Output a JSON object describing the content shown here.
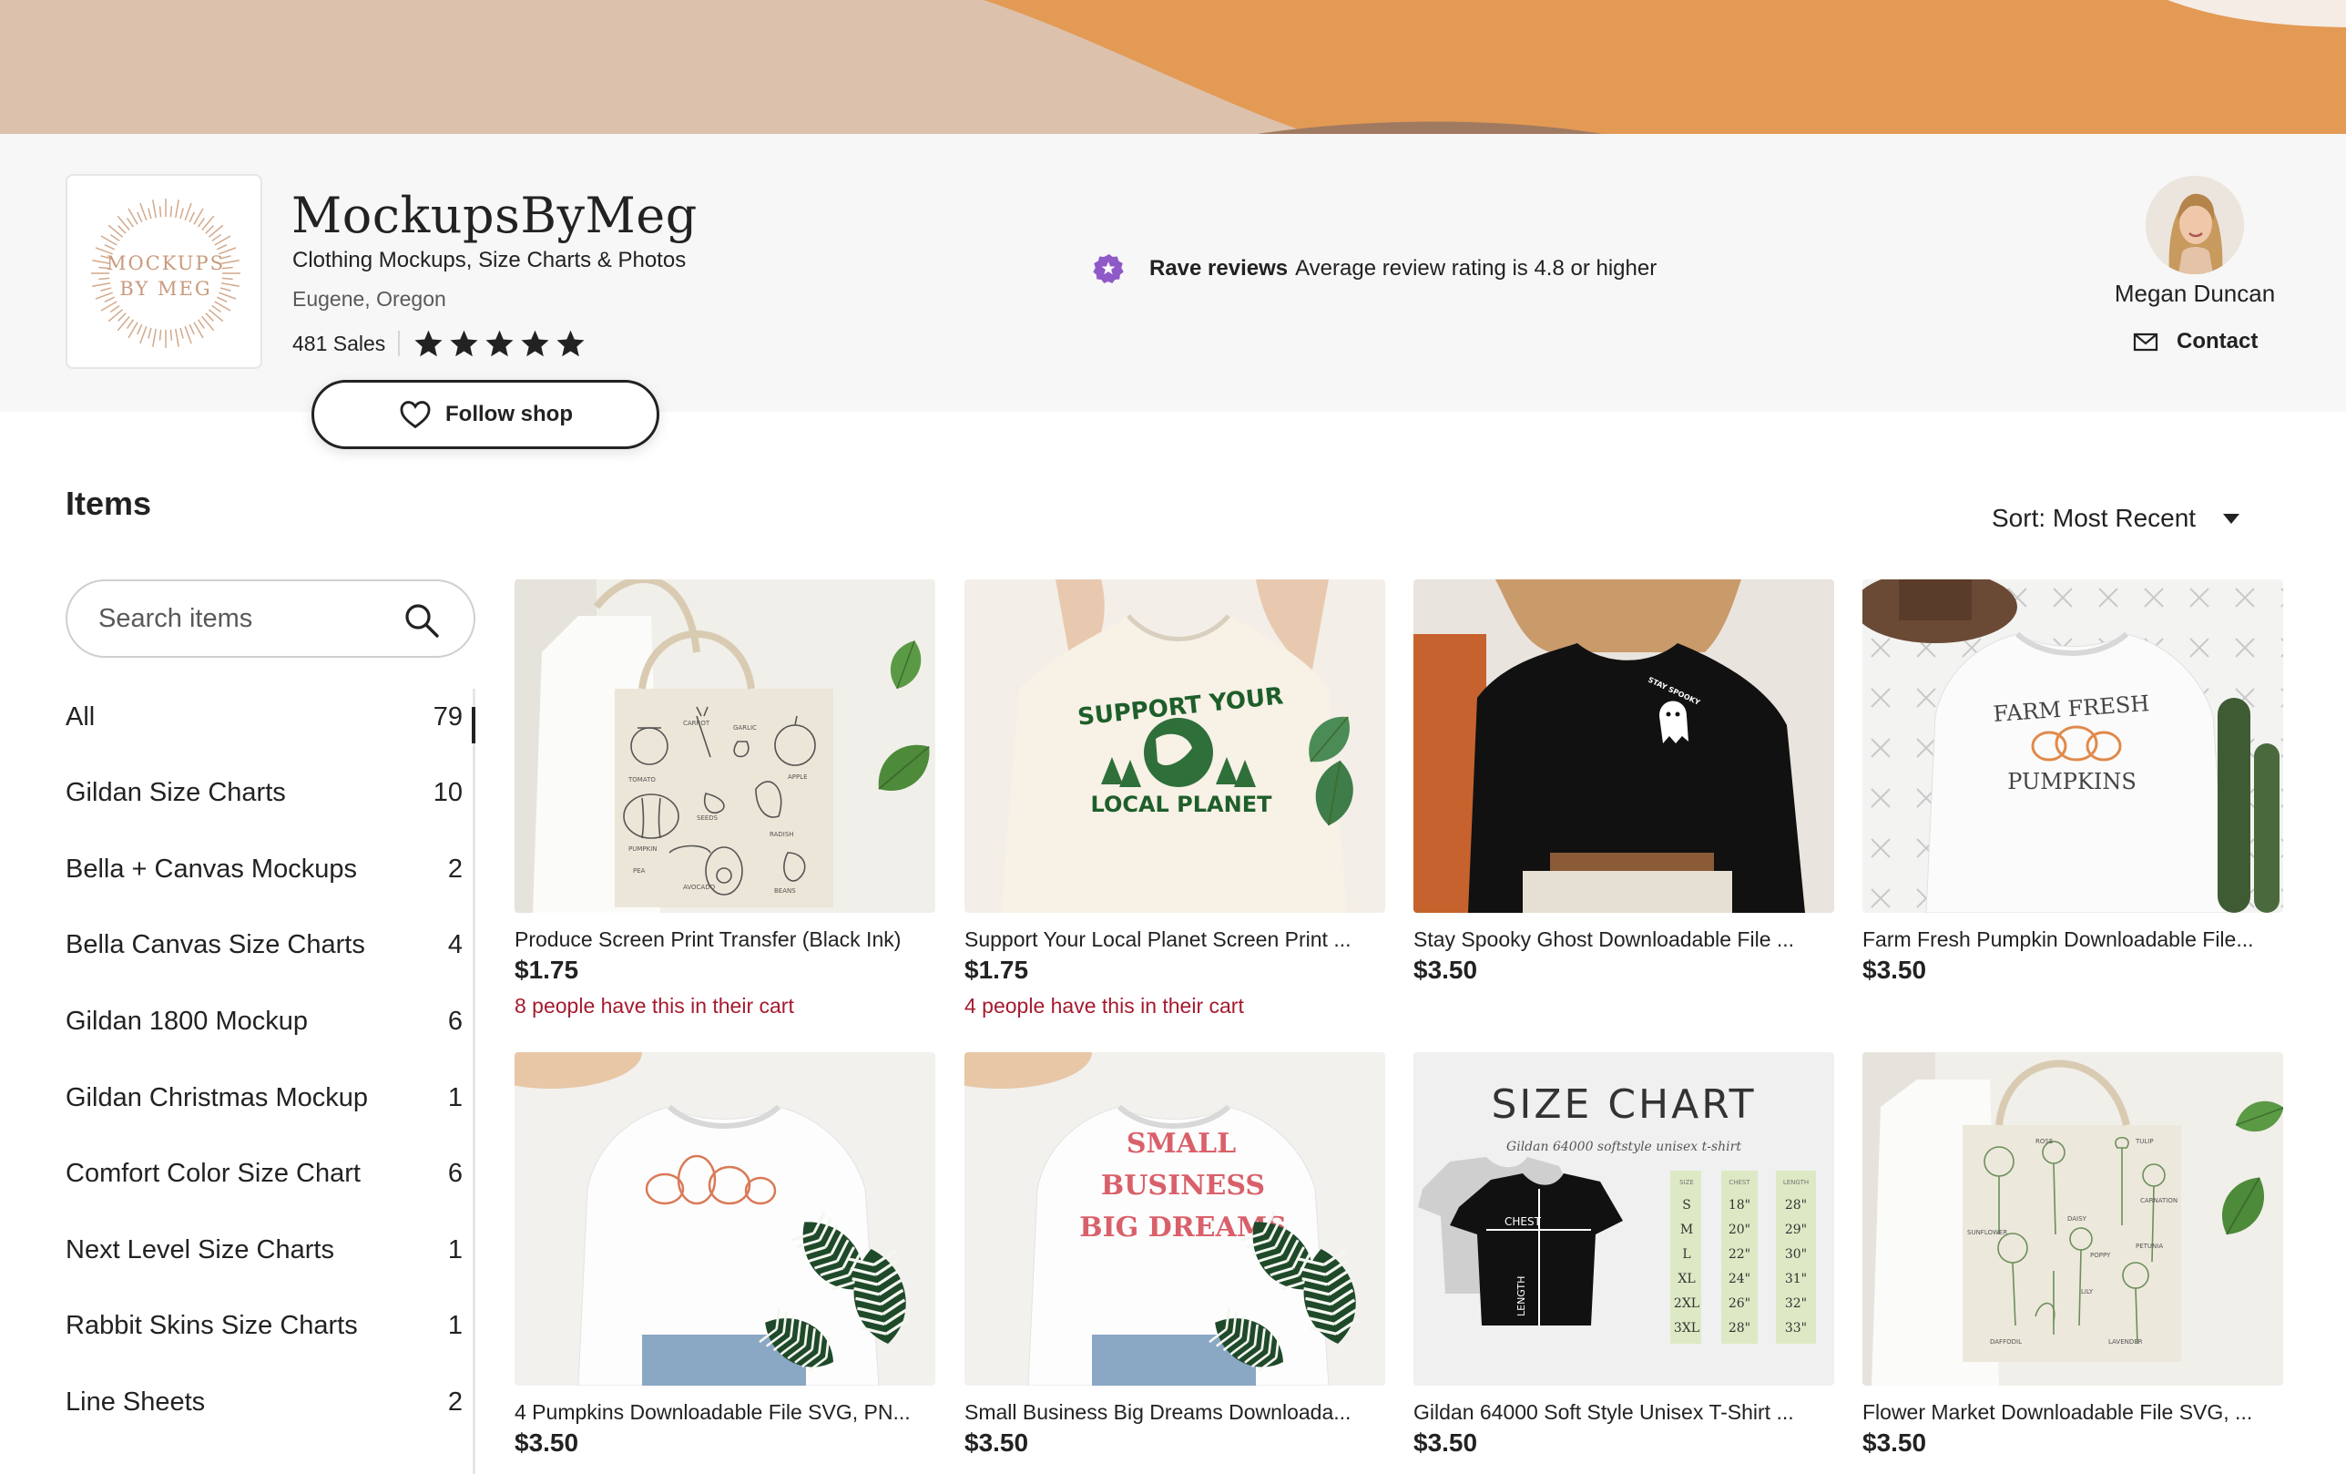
{
  "colors": {
    "banner_tan": "#dcc1ad",
    "banner_orange": "#e39a55",
    "header_bg": "#f7f7f7",
    "rave_purple": "#8f5ac7",
    "cart_red": "#a61a2e",
    "text": "#222222"
  },
  "shop": {
    "logo_line1": "MOCKUPS",
    "logo_line2": "BY MEG",
    "name": "MockupsByMeg",
    "tagline": "Clothing Mockups, Size Charts & Photos",
    "location": "Eugene, Oregon",
    "sales": "481 Sales",
    "rating_stars": 5,
    "follow_label": "Follow shop"
  },
  "badge": {
    "title": "Rave reviews",
    "description": "Average review rating is 4.8 or higher"
  },
  "owner": {
    "name": "Megan Duncan",
    "contact_label": "Contact"
  },
  "items_heading": "Items",
  "sort_label": "Sort: Most Recent",
  "search": {
    "placeholder": "Search items"
  },
  "sections": [
    {
      "label": "All",
      "count": "79"
    },
    {
      "label": "Gildan Size Charts",
      "count": "10"
    },
    {
      "label": "Bella + Canvas Mockups",
      "count": "2"
    },
    {
      "label": "Bella Canvas Size Charts",
      "count": "4"
    },
    {
      "label": "Gildan 1800 Mockup",
      "count": "6"
    },
    {
      "label": "Gildan Christmas Mockup",
      "count": "1"
    },
    {
      "label": "Comfort Color Size Chart",
      "count": "6"
    },
    {
      "label": "Next Level Size Charts",
      "count": "1"
    },
    {
      "label": "Rabbit Skins Size Charts",
      "count": "1"
    },
    {
      "label": "Line Sheets",
      "count": "2"
    }
  ],
  "listings": [
    {
      "title": "Produce Screen Print Transfer (Black Ink)",
      "price": "$1.75",
      "cart_note": "8 people have this in their cart",
      "image": "produce-tote-bag"
    },
    {
      "title": "Support Your Local Planet Screen Print ...",
      "price": "$1.75",
      "cart_note": "4 people have this in their cart",
      "image": "planet-tshirt"
    },
    {
      "title": "Stay Spooky Ghost Downloadable File ...",
      "price": "$3.50",
      "cart_note": "",
      "image": "ghost-sweatshirt"
    },
    {
      "title": "Farm Fresh Pumpkin Downloadable File...",
      "price": "$3.50",
      "cart_note": "",
      "image": "pumpkin-sweatshirt"
    },
    {
      "title": "4 Pumpkins Downloadable File SVG, PN...",
      "price": "$3.50",
      "cart_note": "",
      "image": "four-pumpkins-sweatshirt"
    },
    {
      "title": "Small Business Big Dreams Downloada...",
      "price": "$3.50",
      "cart_note": "",
      "image": "small-business-sweatshirt"
    },
    {
      "title": "Gildan 64000 Soft Style Unisex T-Shirt ...",
      "price": "$3.50",
      "cart_note": "",
      "image": "size-chart"
    },
    {
      "title": "Flower Market Downloadable File SVG, ...",
      "price": "$3.50",
      "cart_note": "",
      "image": "flower-tote-bag"
    }
  ],
  "image_text": {
    "produce_labels": [
      "CARROT",
      "TOMATO",
      "GARLIC",
      "APPLE",
      "SEEDS",
      "RADISH",
      "PUMPKIN",
      "PEA",
      "AVOCADO",
      "BEANS"
    ],
    "planet_top": "SUPPORT YOUR",
    "planet_bottom": "LOCAL PLANET",
    "ghost_text": "STAY SPOOKY",
    "farm_fresh": "FARM FRESH",
    "pumpkins": "PUMPKINS",
    "biz_line1": "SMALL",
    "biz_line2": "BUSINESS",
    "biz_line3": "BIG DREAMS",
    "size_chart_title": "SIZE CHART",
    "size_chart_subtitle": "Gildan 64000 softstyle unisex t-shirt",
    "chest_label": "CHEST",
    "length_label": "LENGTH",
    "size_headers": [
      "SIZE",
      "CHEST",
      "LENGTH"
    ],
    "sizes": [
      [
        "S",
        "18\"",
        "28\""
      ],
      [
        "M",
        "20\"",
        "29\""
      ],
      [
        "L",
        "22\"",
        "30\""
      ],
      [
        "XL",
        "24\"",
        "31\""
      ],
      [
        "2XL",
        "26\"",
        "32\""
      ],
      [
        "3XL",
        "28\"",
        "33\""
      ]
    ],
    "flower_labels": [
      "ROSE",
      "TULIP",
      "CARNATION",
      "DAISY",
      "SUNFLOWER",
      "POPPY",
      "PETUNIA",
      "LILY",
      "DAFFODIL",
      "LAVENDER"
    ]
  }
}
